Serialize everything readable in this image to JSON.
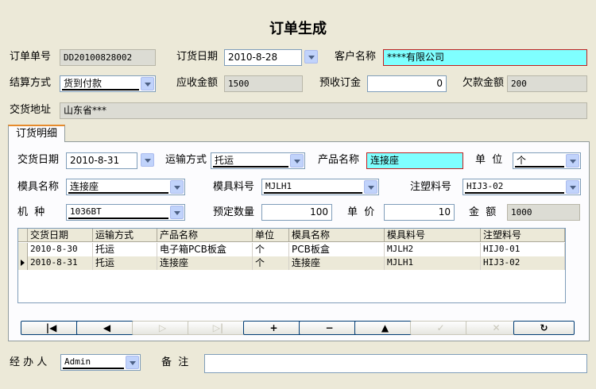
{
  "title": "订单生成",
  "order": {
    "order_no_label": "订单单号",
    "order_no_value": "DD20100828002",
    "order_date_label": "订货日期",
    "order_date_value": "2010-8-28",
    "customer_label": "客户名称",
    "customer_value": "****有限公司",
    "settlement_label": "结算方式",
    "settlement_value": "货到付款",
    "receivable_label": "应收金额",
    "receivable_value": "1500",
    "deposit_label": "预收订金",
    "deposit_value": "0",
    "arrears_label": "欠款金额",
    "arrears_value": "200",
    "address_label": "交货地址",
    "address_value": "山东省***"
  },
  "tab": {
    "label": "订货明细"
  },
  "detail": {
    "delivery_date_label": "交货日期",
    "delivery_date_value": "2010-8-31",
    "transport_label": "运输方式",
    "transport_value": "托运",
    "product_label": "产品名称",
    "product_value": "连接座",
    "unit_label": "单  位",
    "unit_value": "个",
    "mold_name_label": "模具名称",
    "mold_name_value": "连接座",
    "mold_material_label": "模具料号",
    "mold_material_value": "MJLH1",
    "injection_label": "注塑料号",
    "injection_value": "HIJ3-02",
    "machine_label": "机  种",
    "machine_value": "1036BT",
    "qty_label": "预定数量",
    "qty_value": "100",
    "price_label": "单  价",
    "price_value": "10",
    "amount_label": "金  额",
    "amount_value": "1000"
  },
  "grid": {
    "columns": [
      "交货日期",
      "运输方式",
      "产品名称",
      "单位",
      "模具名称",
      "模具料号",
      "注塑料号"
    ],
    "rows": [
      [
        "2010-8-30",
        "托运",
        "电子箱PCB板盒",
        "个",
        "PCB板盒",
        "MJLH2",
        "HIJ0-01"
      ],
      [
        "2010-8-31",
        "托运",
        "连接座",
        "个",
        "连接座",
        "MJLH1",
        "HIJ3-02"
      ]
    ],
    "selected_row": 1
  },
  "navigator": [
    {
      "name": "first-record-button",
      "glyph": "|◀",
      "enabled": true
    },
    {
      "name": "prior-record-button",
      "glyph": "◀",
      "enabled": true
    },
    {
      "name": "next-record-button",
      "glyph": "▷",
      "enabled": false
    },
    {
      "name": "last-record-button",
      "glyph": "▷|",
      "enabled": false
    },
    {
      "name": "insert-record-button",
      "glyph": "+",
      "enabled": true
    },
    {
      "name": "delete-record-button",
      "glyph": "−",
      "enabled": true
    },
    {
      "name": "edit-record-button",
      "glyph": "▲",
      "enabled": true
    },
    {
      "name": "post-record-button",
      "glyph": "✓",
      "enabled": false
    },
    {
      "name": "cancel-record-button",
      "glyph": "✕",
      "enabled": false
    },
    {
      "name": "refresh-button",
      "glyph": "↻",
      "enabled": true
    }
  ],
  "footer": {
    "handler_label": "经 办 人",
    "handler_value": "Admin",
    "remark_label": "备  注",
    "remark_value": ""
  },
  "colors": {
    "window_bg": "#ece9d8",
    "highlight_field": "#7fffff",
    "tab_accent": "#e68b2c"
  }
}
